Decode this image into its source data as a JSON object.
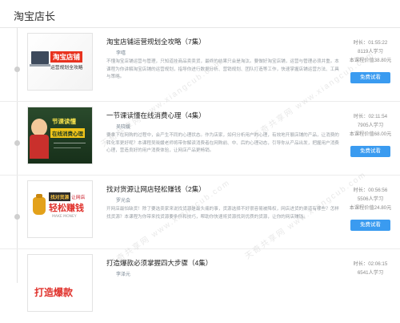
{
  "header": {
    "title": "淘宝店长"
  },
  "courses": [
    {
      "title": "淘宝店铺运营规划全攻略（7集）",
      "teacher": "李嘻",
      "desc": "不懂淘宝店铺运营与管理，只知道挂商品卖卖货，最终的结果只会是淘汰。要做好淘宝店铺，运营与管理必须并重。本课程为你讲解淘宝店铺的运营规划，指导你进行数据分析、营销规划、团队打造等工作，快速掌握店铺运营方法、工具与策略。",
      "duration": "时长：01:55:22",
      "learners": "8119人学习",
      "price": "本课程价值38.80元",
      "button": "免费试看",
      "thumb": {
        "line1": "淘宝店铺",
        "line2": "运营规划全攻略"
      }
    },
    {
      "title": "一节课读懂在线消费心理（4集）",
      "teacher": "吴晓媛",
      "desc": "要拿下在网购的过程中，会产生不同的心理状态。作为店家，如何分析用户的心理，有效地开展店铺的产品，让消费的转化率更好呢？本课程吴晓媛老师将带你解读消费者在网购前、中、后的心理动态，引导你从产品出发，把握用户消费心理，营造良好的用户消费体验，让网店产品更畅销。",
      "duration": "时长：02:11:54",
      "learners": "7905人学习",
      "price": "本课程价值68.00元",
      "button": "免费试看",
      "thumb": {
        "line1": "节课读懂",
        "line2": "在线消费心理"
      }
    },
    {
      "title": "找对货源让网店轻松赚钱（2集）",
      "teacher": "罗光会",
      "desc": "开网店最怕缺货！除了要选卖家来说找货源是最头痛的事，货源选择不好很容易被降权，网店进货的渠道有哪些？怎样找货源？本课程为你带来找货源要条件和技巧，帮助你快速将货源找到优质的货源，让你的网店赚钱。",
      "duration": "时长：00:56:56",
      "learners": "5506人学习",
      "price": "本课程价值24.80元",
      "button": "免费试看",
      "thumb": {
        "line1": "找对货源",
        "line2": "让网店",
        "line3": "轻松赚钱",
        "line4": "MAKE MONEY"
      }
    },
    {
      "title": "打造爆款必须掌握四大步骤（4集）",
      "teacher": "李泽元",
      "desc": "",
      "duration": "时长：02:06:15",
      "learners": "6541人学习",
      "price": "",
      "button": "",
      "thumb": {
        "line1": "打造爆款"
      }
    }
  ],
  "watermark": "天奇共享网 www.xiangcub.com"
}
